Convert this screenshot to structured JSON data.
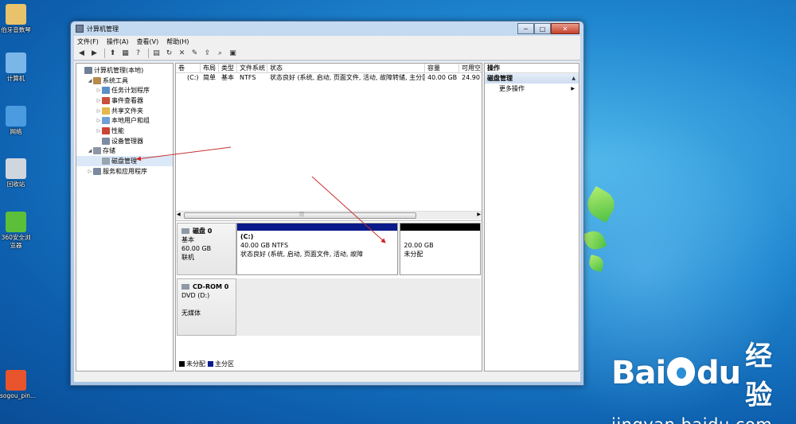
{
  "desktop": {
    "icons": [
      {
        "label": "伯牙音数琴",
        "color": "#e8c36b"
      },
      {
        "label": "计算机",
        "color": "#7ab6e8"
      },
      {
        "label": "网络",
        "color": "#4a9be0"
      },
      {
        "label": "回收站",
        "color": "#cfd6de"
      },
      {
        "label": "360安全浏览器",
        "color": "#5cbf3a"
      },
      {
        "label": "sogou_pin...",
        "color": "#e8542c"
      }
    ],
    "watermark": {
      "brand": "Bai",
      "brand_tail": "du",
      "cn": "经验",
      "url": "jingyan.baidu.com"
    }
  },
  "window": {
    "title": "计算机管理",
    "title_buttons": [
      "─",
      "□",
      "✕"
    ],
    "menu": [
      "文件(F)",
      "操作(A)",
      "查看(V)",
      "帮助(H)"
    ],
    "toolbar_icons": [
      "back-icon",
      "forward-icon",
      "up-icon",
      "console-tree-icon",
      "help-icon",
      "view-icon",
      "refresh-icon",
      "delete-icon",
      "properties-icon",
      "export-icon",
      "search-icon",
      "settings-icon"
    ],
    "toolbar_glyphs": [
      "◀",
      "▶",
      "⬆",
      "▦",
      "?",
      "▤",
      "↻",
      "✕",
      "✎",
      "⇪",
      "⌕",
      "▣"
    ]
  },
  "tree": {
    "items": [
      {
        "label": "计算机管理(本地)",
        "twisty": "",
        "indent": 0,
        "icon_color": "#6f7f95"
      },
      {
        "label": "系统工具",
        "twisty": "◢",
        "indent": 1,
        "icon_color": "#b58a4a"
      },
      {
        "label": "任务计划程序",
        "twisty": "▷",
        "indent": 2,
        "icon_color": "#5b8fc7"
      },
      {
        "label": "事件查看器",
        "twisty": "▷",
        "indent": 2,
        "icon_color": "#c9503c"
      },
      {
        "label": "共享文件夹",
        "twisty": "▷",
        "indent": 2,
        "icon_color": "#e2b84a"
      },
      {
        "label": "本地用户和组",
        "twisty": "▷",
        "indent": 2,
        "icon_color": "#6f9fd6"
      },
      {
        "label": "性能",
        "twisty": "▷",
        "indent": 2,
        "icon_color": "#cc4433"
      },
      {
        "label": "设备管理器",
        "twisty": "",
        "indent": 2,
        "icon_color": "#7d8ca2"
      },
      {
        "label": "存储",
        "twisty": "◢",
        "indent": 1,
        "icon_color": "#8c96a5"
      },
      {
        "label": "磁盘管理",
        "twisty": "",
        "indent": 2,
        "icon_color": "#9aa4b1",
        "selected": true
      },
      {
        "label": "服务和应用程序",
        "twisty": "▷",
        "indent": 1,
        "icon_color": "#7c8aa0"
      }
    ]
  },
  "volumes": {
    "headers": [
      "卷",
      "布局",
      "类型",
      "文件系统",
      "状态",
      "容量",
      "可用空"
    ],
    "rows": [
      [
        "(C:)",
        "简单",
        "基本",
        "NTFS",
        "状态良好 (系统, 启动, 页面文件, 活动, 故障转储, 主分区)",
        "40.00 GB",
        "24.90"
      ]
    ],
    "scroll_grip": "|||"
  },
  "disks": [
    {
      "name": "磁盘 0",
      "type": "基本",
      "size": "60.00 GB",
      "status": "联机",
      "partitions": [
        {
          "title": "(C:)",
          "line1": "40.00 GB NTFS",
          "line2": "状态良好 (系统, 启动, 页面文件, 活动, 故障",
          "share": 0.667,
          "bar_color": "#0a1a8a"
        },
        {
          "title": "",
          "line1": "20.00 GB",
          "line2": "未分配",
          "share": 0.333,
          "bar_color": "#000000"
        }
      ]
    },
    {
      "name": "CD-ROM 0",
      "type": "DVD (D:)",
      "size": "",
      "status": "无媒体",
      "partitions": []
    }
  ],
  "legend": [
    {
      "label": "未分配",
      "color": "#000000"
    },
    {
      "label": "主分区",
      "color": "#0a1a8a"
    }
  ],
  "actions": {
    "header": "操作",
    "section": "磁盘管理",
    "section_arrow": "▲",
    "items": [
      {
        "label": "更多操作",
        "arrow": "▶"
      }
    ]
  }
}
